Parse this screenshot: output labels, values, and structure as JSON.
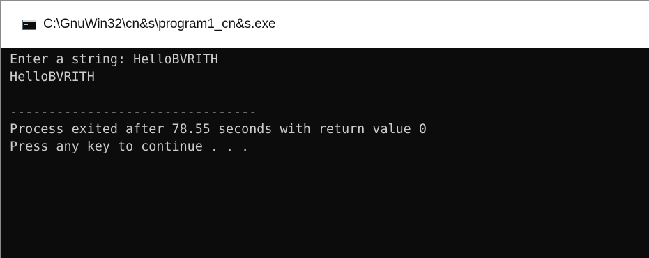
{
  "window": {
    "title": "C:\\GnuWin32\\cn&s\\program1_cn&s.exe",
    "icon": "console-app-icon"
  },
  "console": {
    "lines": [
      "Enter a string: HelloBVRITH",
      "HelloBVRITH",
      "",
      "--------------------------------",
      "Process exited after 78.55 seconds with return value 0",
      "Press any key to continue . . ."
    ]
  },
  "colors": {
    "console_background": "#0c0c0c",
    "console_text": "#cccccc",
    "titlebar_background": "#ffffff",
    "title_text": "#111111"
  }
}
